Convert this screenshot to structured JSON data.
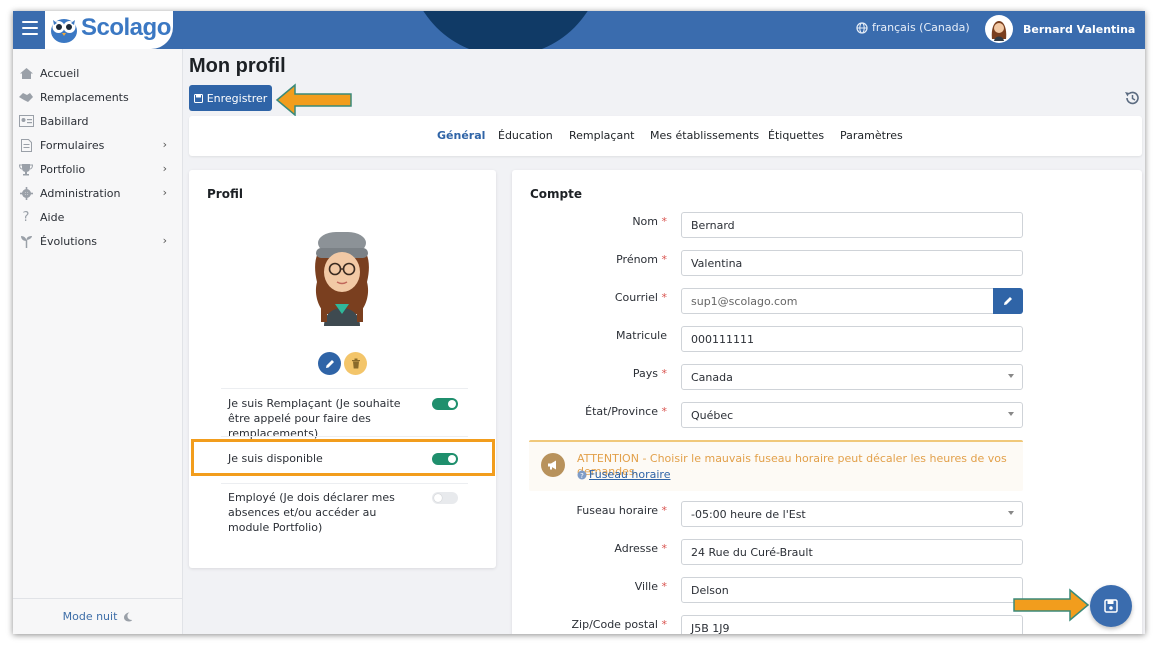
{
  "header": {
    "logo_text": "Scolago",
    "language": "français (Canada)",
    "user_name": "Bernard Valentina"
  },
  "sidebar": {
    "items": [
      {
        "label": "Accueil",
        "icon": "home-icon",
        "has_submenu": false
      },
      {
        "label": "Remplacements",
        "icon": "handshake-icon",
        "has_submenu": false
      },
      {
        "label": "Babillard",
        "icon": "id-card-icon",
        "has_submenu": false
      },
      {
        "label": "Formulaires",
        "icon": "document-icon",
        "has_submenu": true
      },
      {
        "label": "Portfolio",
        "icon": "trophy-icon",
        "has_submenu": true
      },
      {
        "label": "Administration",
        "icon": "gear-icon",
        "has_submenu": true
      },
      {
        "label": "Aide",
        "icon": "question-icon",
        "has_submenu": false
      },
      {
        "label": "Évolutions",
        "icon": "sprout-icon",
        "has_submenu": true
      }
    ],
    "night_mode": "Mode nuit"
  },
  "page": {
    "title": "Mon profil",
    "save_label": "Enregistrer"
  },
  "tabs": [
    {
      "label": "Général",
      "active": true
    },
    {
      "label": "Éducation",
      "active": false
    },
    {
      "label": "Remplaçant",
      "active": false
    },
    {
      "label": "Mes établissements",
      "active": false
    },
    {
      "label": "Étiquettes",
      "active": false
    },
    {
      "label": "Paramètres",
      "active": false
    }
  ],
  "profile": {
    "title": "Profil",
    "options": [
      {
        "label": "Je suis Remplaçant (Je souhaite être appelé pour faire des remplacements)",
        "enabled": true
      },
      {
        "label": "Je suis disponible",
        "enabled": true
      },
      {
        "label": "Employé (Je dois déclarer mes absences et/ou accéder au module Portfolio)",
        "enabled": false
      }
    ]
  },
  "account": {
    "title": "Compte",
    "fields": {
      "nom": {
        "label": "Nom",
        "value": "Bernard"
      },
      "prenom": {
        "label": "Prénom",
        "value": "Valentina"
      },
      "courriel": {
        "label": "Courriel",
        "value": "sup1@scolago.com"
      },
      "matricule": {
        "label": "Matricule",
        "value": "000111111"
      },
      "pays": {
        "label": "Pays",
        "value": "Canada"
      },
      "etat": {
        "label": "État/Province",
        "value": "Québec"
      },
      "fuseau": {
        "label": "Fuseau horaire",
        "value": "-05:00 heure de l'Est"
      },
      "adresse": {
        "label": "Adresse",
        "value": "24 Rue du Curé-Brault"
      },
      "ville": {
        "label": "Ville",
        "value": "Delson"
      },
      "zip": {
        "label": "Zip/Code postal",
        "value": "J5B 1J9"
      }
    },
    "required_mark": "*",
    "alert": {
      "message": "ATTENTION - Choisir le mauvais fuseau horaire peut décaler les heures de vos demandes.",
      "link": "Fuseau horaire"
    }
  },
  "colors": {
    "header": "#3a6cae",
    "primary": "#2f64a7",
    "toggle_on": "#1f8f6d",
    "annotation": "#f29d1d"
  }
}
